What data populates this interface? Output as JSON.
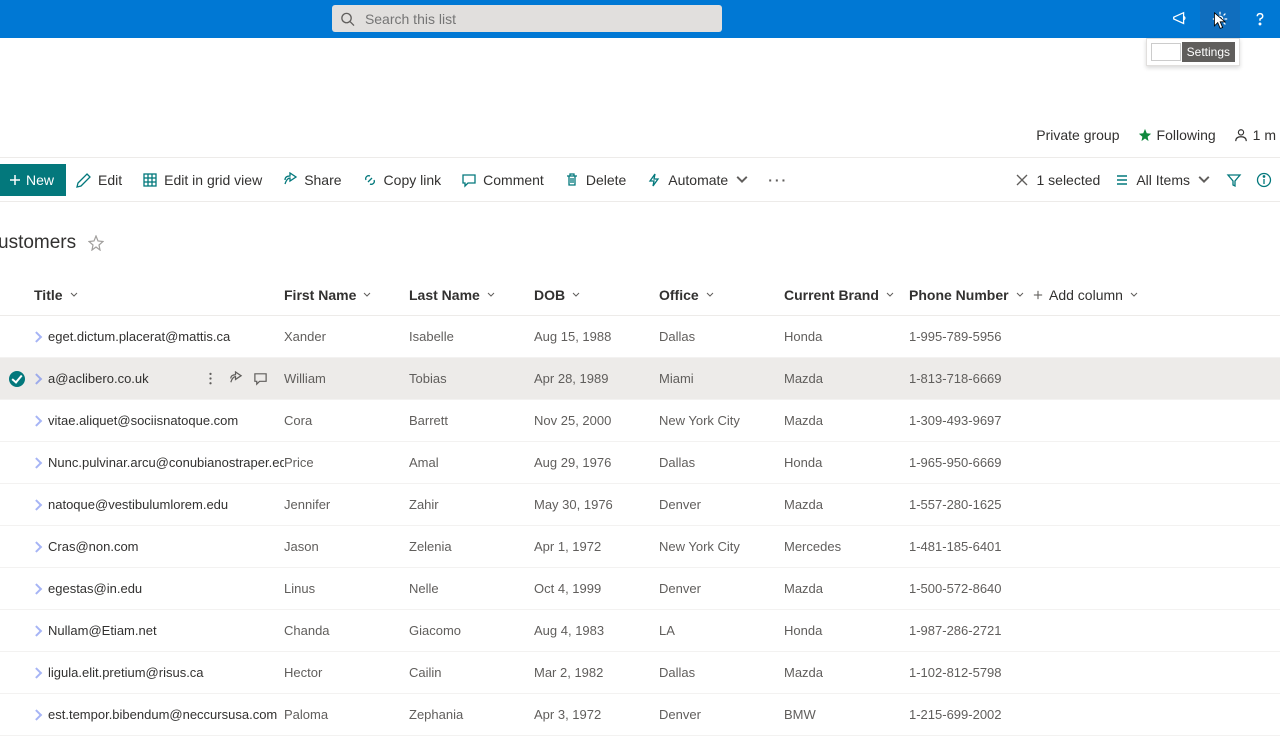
{
  "header": {
    "search_placeholder": "Search this list",
    "settings_tooltip": "Settings"
  },
  "meta": {
    "group_type": "Private group",
    "following": "Following",
    "members": "1 m"
  },
  "cmdbar": {
    "new": "New",
    "edit": "Edit",
    "editgrid": "Edit in grid view",
    "share": "Share",
    "copylink": "Copy link",
    "comment": "Comment",
    "delete": "Delete",
    "automate": "Automate",
    "selected": "1 selected",
    "view": "All Items"
  },
  "list": {
    "title": "ustomers"
  },
  "columns": {
    "title": "Title",
    "first_name": "First Name",
    "last_name": "Last Name",
    "dob": "DOB",
    "office": "Office",
    "brand": "Current Brand",
    "phone": "Phone Number",
    "add": "Add column"
  },
  "rows": [
    {
      "title": "eget.dictum.placerat@mattis.ca",
      "first": "Xander",
      "last": "Isabelle",
      "dob": "Aug 15, 1988",
      "office": "Dallas",
      "brand": "Honda",
      "phone": "1-995-789-5956",
      "selected": false
    },
    {
      "title": "a@aclibero.co.uk",
      "first": "William",
      "last": "Tobias",
      "dob": "Apr 28, 1989",
      "office": "Miami",
      "brand": "Mazda",
      "phone": "1-813-718-6669",
      "selected": true
    },
    {
      "title": "vitae.aliquet@sociisnatoque.com",
      "first": "Cora",
      "last": "Barrett",
      "dob": "Nov 25, 2000",
      "office": "New York City",
      "brand": "Mazda",
      "phone": "1-309-493-9697",
      "selected": false
    },
    {
      "title": "Nunc.pulvinar.arcu@conubianostraper.edu",
      "first": "Price",
      "last": "Amal",
      "dob": "Aug 29, 1976",
      "office": "Dallas",
      "brand": "Honda",
      "phone": "1-965-950-6669",
      "selected": false
    },
    {
      "title": "natoque@vestibulumlorem.edu",
      "first": "Jennifer",
      "last": "Zahir",
      "dob": "May 30, 1976",
      "office": "Denver",
      "brand": "Mazda",
      "phone": "1-557-280-1625",
      "selected": false
    },
    {
      "title": "Cras@non.com",
      "first": "Jason",
      "last": "Zelenia",
      "dob": "Apr 1, 1972",
      "office": "New York City",
      "brand": "Mercedes",
      "phone": "1-481-185-6401",
      "selected": false
    },
    {
      "title": "egestas@in.edu",
      "first": "Linus",
      "last": "Nelle",
      "dob": "Oct 4, 1999",
      "office": "Denver",
      "brand": "Mazda",
      "phone": "1-500-572-8640",
      "selected": false
    },
    {
      "title": "Nullam@Etiam.net",
      "first": "Chanda",
      "last": "Giacomo",
      "dob": "Aug 4, 1983",
      "office": "LA",
      "brand": "Honda",
      "phone": "1-987-286-2721",
      "selected": false
    },
    {
      "title": "ligula.elit.pretium@risus.ca",
      "first": "Hector",
      "last": "Cailin",
      "dob": "Mar 2, 1982",
      "office": "Dallas",
      "brand": "Mazda",
      "phone": "1-102-812-5798",
      "selected": false
    },
    {
      "title": "est.tempor.bibendum@neccursusa.com",
      "first": "Paloma",
      "last": "Zephania",
      "dob": "Apr 3, 1972",
      "office": "Denver",
      "brand": "BMW",
      "phone": "1-215-699-2002",
      "selected": false
    }
  ]
}
